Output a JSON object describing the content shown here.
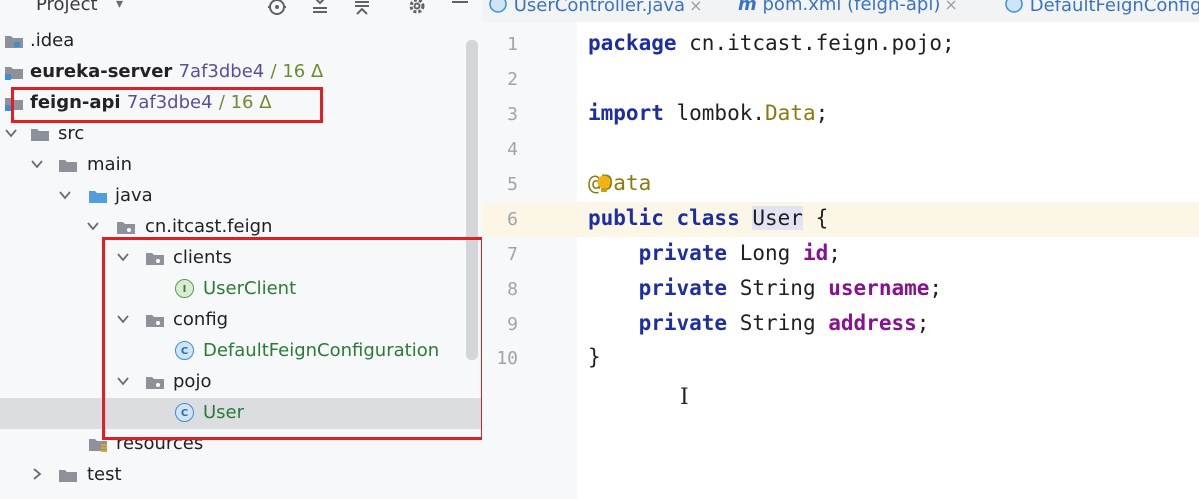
{
  "project": {
    "title": "Project",
    "dropdown": "▾",
    "tree": [
      {
        "label": "idea",
        "hash": "",
        "count": ""
      },
      {
        "label": "eureka-server",
        "hash": "7af3dbe4",
        "count": "/ 16 Δ"
      },
      {
        "label": "feign-api",
        "hash": "7af3dbe4",
        "count": "/ 16 Δ"
      },
      {
        "label": "src"
      },
      {
        "label": "main"
      },
      {
        "label": "java"
      },
      {
        "label": "cn.itcast.feign"
      },
      {
        "label": "clients"
      },
      {
        "label": "UserClient",
        "badge": "I"
      },
      {
        "label": "config"
      },
      {
        "label": "DefaultFeignConfiguration",
        "badge": "C"
      },
      {
        "label": "pojo"
      },
      {
        "label": "User",
        "badge": "C"
      },
      {
        "label": "resources"
      },
      {
        "label": "test"
      }
    ]
  },
  "tabs": [
    {
      "label": "UserController.java",
      "close": "×"
    },
    {
      "label": "pom.xml (feign-api)",
      "close": "×"
    },
    {
      "label": "DefaultFeignConfiguration"
    }
  ],
  "editor": {
    "line_numbers": [
      "1",
      "2",
      "3",
      "4",
      "5",
      "6",
      "7",
      "8",
      "9",
      "10"
    ],
    "pkg": {
      "kw": "package",
      "rest": " cn.itcast.feign.pojo;"
    },
    "imp": {
      "kw": "import",
      "mid": " lombok.",
      "ann": "Data",
      "end": ";"
    },
    "anno": {
      "at": "@",
      "name": "Data"
    },
    "cls": {
      "kw1": "public",
      "kw2": " class",
      "sp": " ",
      "name": "User",
      "brace": " {"
    },
    "fields": [
      {
        "kw": "private",
        "type": " Long ",
        "name": "id",
        "end": ";"
      },
      {
        "kw": "private",
        "type": " String ",
        "name": "username",
        "end": ";"
      },
      {
        "kw": "private",
        "type": " String ",
        "name": "address",
        "end": ";"
      }
    ],
    "close_brace": "}",
    "cursor": "I"
  },
  "colors": {
    "highlight_box": "#e01e24",
    "selection": "#dcdde0",
    "current_line": "#fbf6e6"
  }
}
